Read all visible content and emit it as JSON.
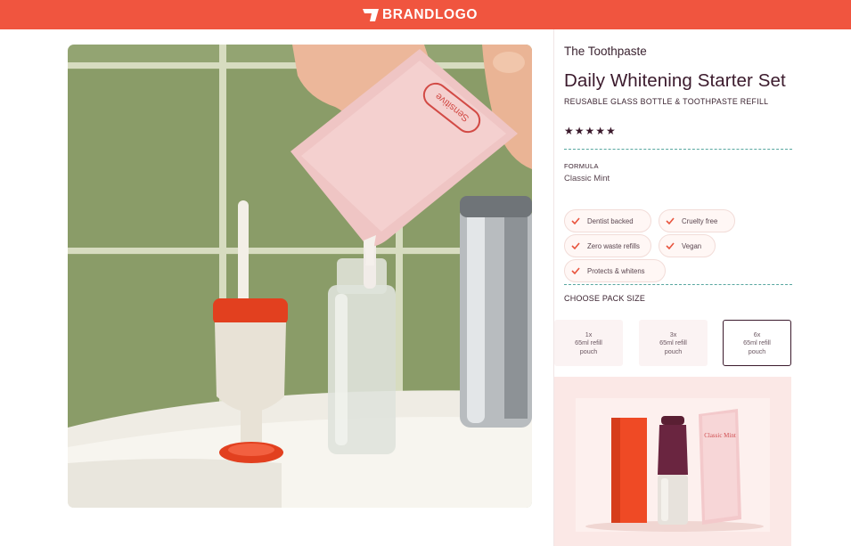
{
  "header": {
    "logo_text": "BRANDLOGO",
    "background_color": "#f0553f"
  },
  "hero": {
    "pouch_lettering": "Sensitive"
  },
  "product": {
    "eyebrow": "The Toothpaste",
    "title": "Daily Whitening Starter Set",
    "subtitle": "REUSABLE GLASS BOTTLE & TOOTHPASTE REFILL",
    "rating_stars": "★★★★★",
    "formula_label": "FORMULA",
    "formula_value": "Classic Mint"
  },
  "badges": [
    {
      "label": "Dentist backed",
      "icon": "check-icon"
    },
    {
      "label": "Cruelty free",
      "icon": "check-icon"
    },
    {
      "label": "Zero waste refills",
      "icon": "check-icon"
    },
    {
      "label": "Vegan",
      "icon": "check-icon"
    },
    {
      "label": "Protects & whitens",
      "icon": "check-icon"
    }
  ],
  "pack_size": {
    "heading": "CHOOSE PACK SIZE",
    "options": [
      {
        "qty": "1x",
        "line1": "65ml refill",
        "line2": "pouch",
        "selected": false
      },
      {
        "qty": "3x",
        "line1": "65ml refill",
        "line2": "pouch",
        "selected": false
      },
      {
        "qty": "6x",
        "line1": "65ml refill",
        "line2": "pouch",
        "selected": true
      }
    ]
  },
  "product_photo": {
    "pouch_lettering": "Classic Mint"
  },
  "colors": {
    "accent": "#f0553f",
    "text_dark": "#3b1a2c",
    "divider": "#58a7a0",
    "badge_bg": "#fff7f5"
  }
}
